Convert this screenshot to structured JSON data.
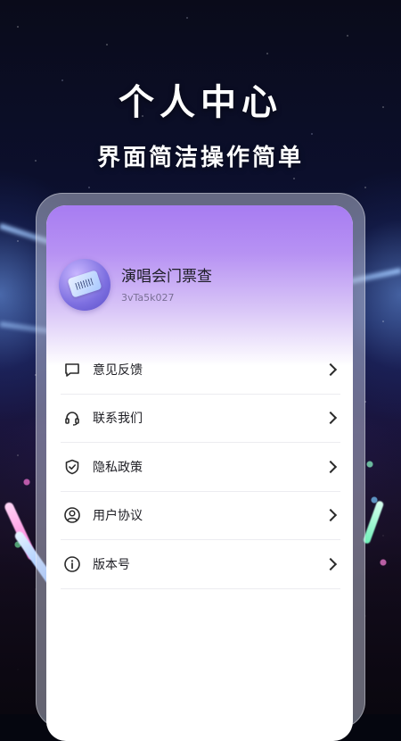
{
  "hero": {
    "title": "个人中心",
    "subtitle": "界面简洁操作简单"
  },
  "profile": {
    "app_name": "演唱会门票查",
    "user_id": "3vTa5k027",
    "avatar_icon": "ticket-icon"
  },
  "menu": {
    "items": [
      {
        "label": "意见反馈",
        "icon": "message-icon"
      },
      {
        "label": "联系我们",
        "icon": "headset-icon"
      },
      {
        "label": "隐私政策",
        "icon": "shield-check-icon"
      },
      {
        "label": "用户协议",
        "icon": "user-circle-icon"
      },
      {
        "label": "版本号",
        "icon": "info-icon"
      }
    ]
  },
  "colors": {
    "header_gradient_top": "#a77cf2",
    "text_primary": "#1e1e24",
    "divider": "#ececf0"
  }
}
